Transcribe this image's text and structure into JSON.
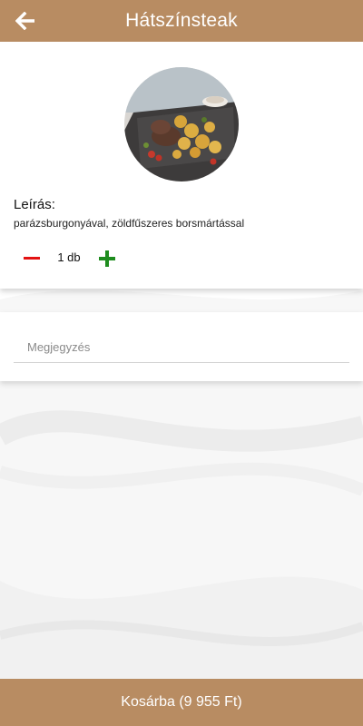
{
  "header": {
    "title": "Hátszínsteak",
    "back_icon": "arrow-left-icon"
  },
  "product": {
    "image_icon": "food-photo",
    "description_label": "Leírás:",
    "description": "parázsburgonyával, zöldfűszeres borsmártással"
  },
  "quantity": {
    "value": "1 db",
    "minus_icon": "minus-icon",
    "plus_icon": "plus-icon"
  },
  "note": {
    "placeholder": "Megjegyzés",
    "value": ""
  },
  "footer": {
    "cart_label": "Kosárba (9 955 Ft)"
  },
  "colors": {
    "brand": "#b88c62",
    "minus": "#e31212",
    "plus": "#1e8c1e"
  }
}
